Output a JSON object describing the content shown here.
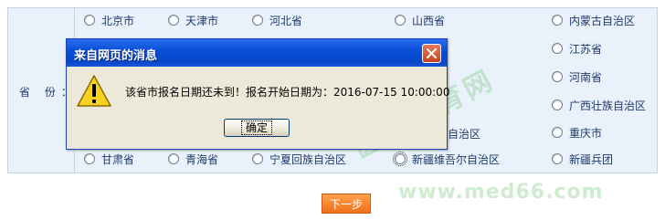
{
  "form": {
    "row_label": "省  份：",
    "options": {
      "beijing": "北京市",
      "tianjin": "天津市",
      "hebei": "河北省",
      "shanxi": "山西省",
      "neimenggu": "内蒙古自治区",
      "jiangsu": "江苏省",
      "henan": "河南省",
      "guangxi": "广西壮族自治区",
      "xizang_partial": "自治区",
      "chongqing": "重庆市",
      "gansu": "甘肃省",
      "qinghai": "青海省",
      "ningxia": "宁夏回族自治区",
      "xinjiang": "新疆维吾尔自治区",
      "bingtuan": "新疆兵团"
    },
    "next_label": "下一步"
  },
  "watermark": {
    "text1": "医学教育网",
    "text2": "www.med66.com"
  },
  "dialog": {
    "title": "来自网页的消息",
    "message": "该省市报名日期还未到！报名开始日期为：2016-07-15 10:00:00",
    "ok_label": "确定"
  },
  "colors": {
    "panel_bg": "#e9f1fa",
    "title_bar": "#0a4fd8",
    "next_button": "#f0701a"
  }
}
